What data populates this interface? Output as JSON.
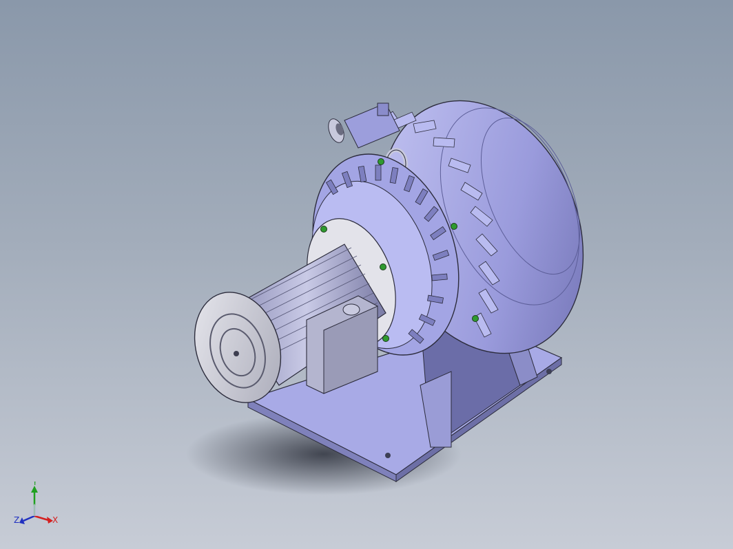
{
  "viewport": {
    "background_top": "#8a98aa",
    "background_bottom": "#c7ccd6",
    "model_color": "#a6a8e4",
    "model_shadow": "#4a4f5c",
    "fastener_color": "#2f9a2f"
  },
  "triad": {
    "x_label": "X",
    "y_label": "Y",
    "z_label": "Z",
    "x_color": "#d42020",
    "y_color": "#20a020",
    "z_color": "#2030c0"
  }
}
